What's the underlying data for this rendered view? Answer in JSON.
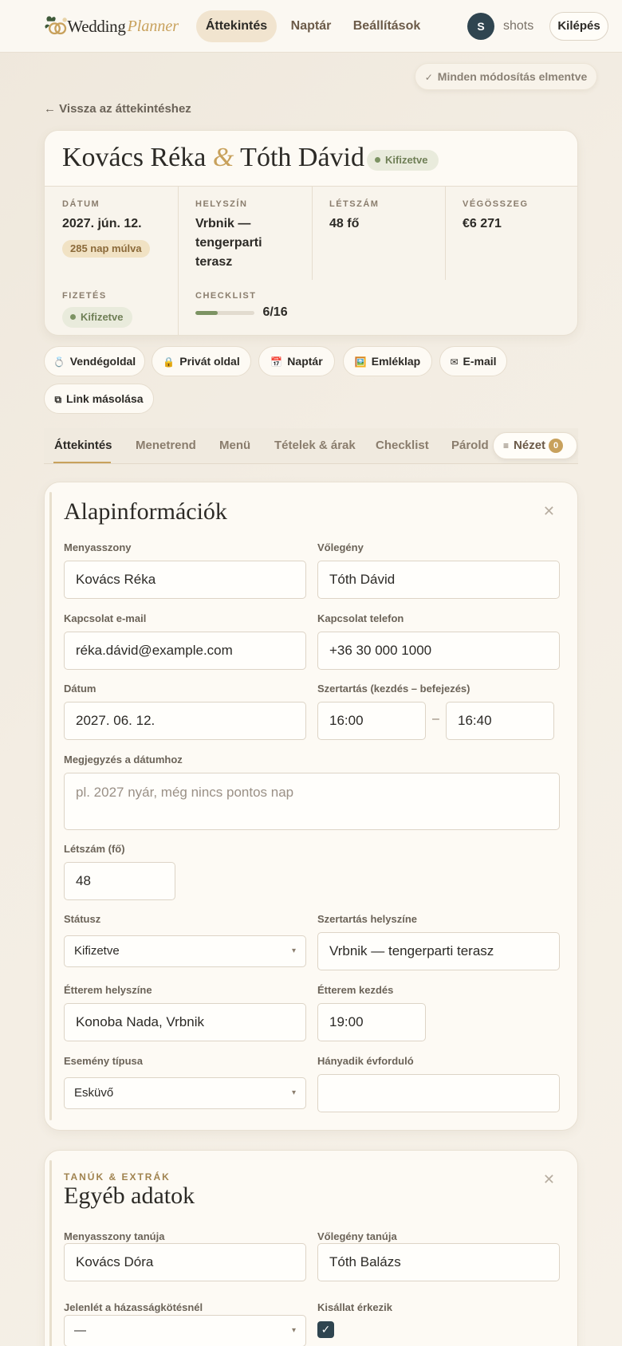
{
  "logo": {
    "word": "Wedding",
    "script": "Planner"
  },
  "nav": {
    "items": [
      "Áttekintés",
      "Naptár",
      "Beállítások"
    ],
    "active": 0
  },
  "user": {
    "initial": "S",
    "name": "shots",
    "logout": "Kilépés"
  },
  "status_pill": "Minden módosítás elmentve",
  "back_link": "Vissza az áttekintéshez",
  "header": {
    "bride": "Kovács Réka",
    "amp": "&",
    "groom": "Tóth Dávid",
    "status": "Kifizetve",
    "stats": {
      "date": {
        "label": "DÁTUM",
        "value": "2027. jún. 12.",
        "due": "285 nap múlva"
      },
      "venue": {
        "label": "HELYSZÍN",
        "value": "Vrbnik — tengerparti terasz"
      },
      "guests": {
        "label": "LÉTSZÁM",
        "value": "48 fő"
      },
      "total": {
        "label": "VÉGÖSSZEG",
        "value": "€6 271"
      },
      "payment": {
        "label": "FIZETÉS",
        "value": "Kifizetve"
      },
      "checklist": {
        "label": "CHECKLIST",
        "value": "6/16",
        "done": 6,
        "total": 16
      }
    }
  },
  "actions": [
    {
      "icon": "💍",
      "label": "Vendégoldal"
    },
    {
      "icon": "🔒",
      "label": "Privát oldal"
    },
    {
      "icon": "📅",
      "label": "Naptár"
    },
    {
      "icon": "🖼️",
      "label": "Emléklap"
    },
    {
      "icon": "✉",
      "label": "E-mail"
    },
    {
      "icon": "⧉",
      "label": "Link másolása"
    }
  ],
  "tabs": [
    "Áttekintés",
    "Menetrend",
    "Menü",
    "Tételek & árak",
    "Checklist",
    "Párold"
  ],
  "view_button": {
    "label": "Nézet",
    "count": "0"
  },
  "basic": {
    "title": "Alapinformációk",
    "bride_label": "Menyasszony",
    "bride": "Kovács Réka",
    "groom_label": "Vőlegény",
    "groom": "Tóth Dávid",
    "email_label": "Kapcsolat e-mail",
    "email": "réka.dávid@example.com",
    "phone_label": "Kapcsolat telefon",
    "phone": "+36 30 000 1000",
    "date_label": "Dátum",
    "date": "2027. 06. 12.",
    "ceremony_label": "Szertartás (kezdés – befejezés)",
    "ceremony_start": "16:00",
    "dash": "–",
    "ceremony_end": "16:40",
    "note_label": "Megjegyzés a dátumhoz",
    "note_placeholder": "pl. 2027 nyár, még nincs pontos nap",
    "guests_label": "Létszám (fő)",
    "guests": "48",
    "status_label": "Státusz",
    "status": "Kifizetve",
    "ceremony_venue_label": "Szertartás helyszíne",
    "ceremony_venue": "Vrbnik — tengerparti terasz",
    "restaurant_label": "Étterem helyszíne",
    "restaurant": "Konoba Nada, Vrbnik",
    "restaurant_start_label": "Étterem kezdés",
    "restaurant_start": "19:00",
    "event_type_label": "Esemény típusa",
    "event_type": "Esküvő",
    "anniversary_label": "Hányadik évforduló",
    "anniversary": ""
  },
  "other": {
    "eyebrow": "TANÚK & EXTRÁK",
    "title": "Egyéb adatok",
    "bride_witness_label": "Menyasszony tanúja",
    "bride_witness": "Kovács Dóra",
    "groom_witness_label": "Vőlegény tanúja",
    "groom_witness": "Tóth Balázs",
    "presence_label": "Jelenlét a házasságkötésnél",
    "presence": "—",
    "bridesmaid_label": "Kisállat érkezik",
    "bridesmaid_checked": true
  },
  "colors": {
    "accent": "#c8a15c",
    "dark": "#2f4550",
    "paid": "#7c9363",
    "background": "#f3ede3"
  }
}
